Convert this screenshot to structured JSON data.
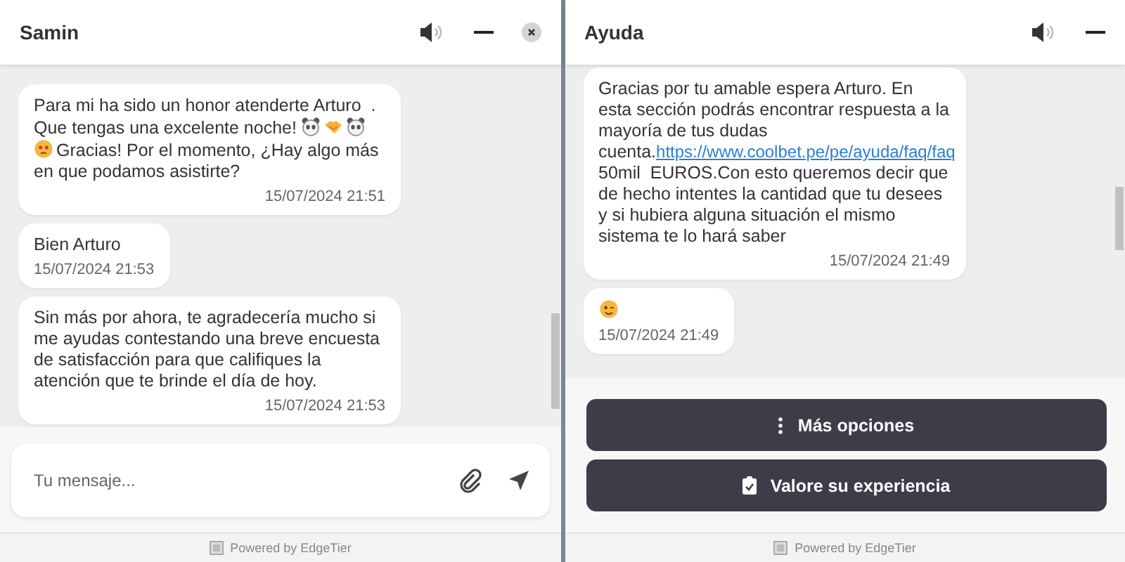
{
  "panels": [
    {
      "title": "Samin",
      "header_icons": [
        {
          "kind": "speaker"
        },
        {
          "kind": "minimize"
        },
        {
          "kind": "close"
        }
      ],
      "messages": [
        {
          "parts": [
            {
              "kind": "text",
              "text": "Para mi ha sido un honor atenderte Arturo  . Que tengas una excelente noche! "
            },
            {
              "kind": "panda"
            },
            {
              "kind": "handshake"
            },
            {
              "kind": "panda"
            },
            {
              "kind": "sad-face"
            },
            {
              "kind": "text",
              "text": "Gracias! Por el momento, ¿Hay algo más en que podamos asistirte?"
            }
          ],
          "time": "15/07/2024 21:51"
        },
        {
          "parts": [
            {
              "kind": "text",
              "text": "Bien Arturo"
            }
          ],
          "time": "15/07/2024 21:53"
        },
        {
          "parts": [
            {
              "kind": "text",
              "text": "Sin más por ahora, te agradecería mucho si me ayudas contestando una breve encuesta de satisfacción para que califiques la atención que te brinde el día de hoy."
            }
          ],
          "time": "15/07/2024 21:53"
        }
      ],
      "composer": {
        "placeholder": "Tu mensaje..."
      },
      "footer": "Powered by EdgeTier"
    },
    {
      "title": "Ayuda",
      "header_icons": [
        {
          "kind": "speaker"
        },
        {
          "kind": "minimize"
        }
      ],
      "messages": [
        {
          "parts": [
            {
              "kind": "text",
              "text": "Gracias por tu amable espera Arturo. En esta sección podrás encontrar respuesta a la mayoría de tus dudas\ncuenta."
            },
            {
              "kind": "link",
              "text": "https://www.coolbet.pe/pe/ayuda/faq/faq"
            },
            {
              "kind": "text",
              "text": "\n50mil  EUROS.Con esto queremos decir que de hecho intentes la cantidad que tu desees y si hubiera alguna situación el mismo sistema te lo hará saber"
            }
          ],
          "time": "15/07/2024 21:49"
        },
        {
          "parts": [
            {
              "kind": "wink-face"
            }
          ],
          "time": "15/07/2024 21:49"
        }
      ],
      "buttons": [
        {
          "kind": "more",
          "label": "Más opciones"
        },
        {
          "kind": "rate",
          "label": "Valore su experiencia"
        }
      ],
      "footer": "Powered by EdgeTier"
    }
  ]
}
